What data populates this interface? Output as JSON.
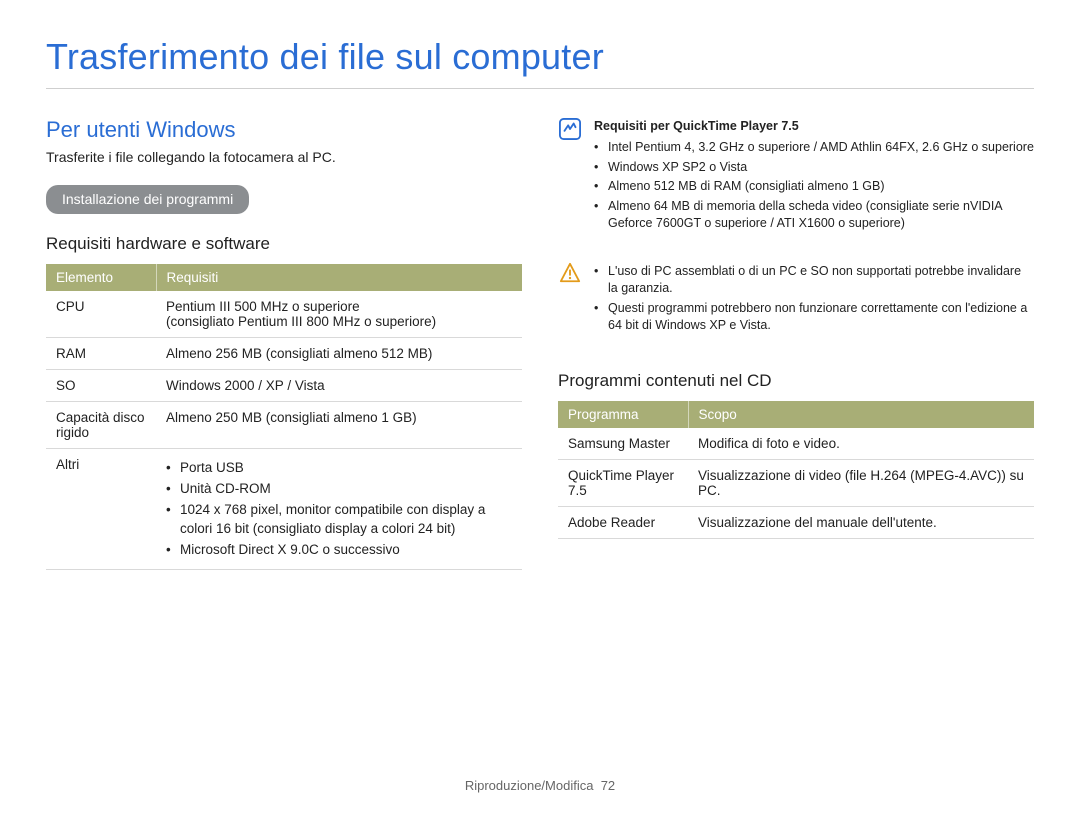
{
  "page": {
    "title": "Trasferimento dei file sul computer",
    "footer_section": "Riproduzione/Modifica",
    "footer_page": "72"
  },
  "left": {
    "heading": "Per utenti Windows",
    "lead": "Trasferite i file collegando la fotocamera al PC.",
    "pill": "Installazione dei programmi",
    "subheading": "Requisiti hardware e software",
    "table": {
      "head": {
        "col1": "Elemento",
        "col2": "Requisiti"
      },
      "rows": [
        {
          "c1": "CPU",
          "c2": "Pentium III 500 MHz o superiore\n(consigliato Pentium III 800 MHz o superiore)"
        },
        {
          "c1": "RAM",
          "c2": "Almeno 256 MB (consigliati almeno 512 MB)"
        },
        {
          "c1": "SO",
          "c2": "Windows 2000 / XP / Vista"
        },
        {
          "c1": "Capacità disco rigido",
          "c2": "Almeno 250 MB (consigliati almeno 1 GB)"
        }
      ],
      "others_label": "Altri",
      "others_items": [
        "Porta USB",
        "Unità CD-ROM",
        "1024 x 768 pixel, monitor compatibile con display a colori 16 bit (consigliato display a colori 24 bit)",
        "Microsoft Direct X 9.0C o successivo"
      ]
    }
  },
  "right": {
    "note1": {
      "title": "Requisiti per QuickTime Player 7.5",
      "items": [
        "Intel Pentium 4, 3.2 GHz o superiore / AMD Athlin 64FX, 2.6 GHz o superiore",
        "Windows XP SP2 o Vista",
        "Almeno 512 MB di RAM (consigliati almeno 1 GB)",
        "Almeno 64 MB di memoria della scheda video (consigliate serie nVIDIA Geforce 7600GT o superiore / ATI X1600 o superiore)"
      ]
    },
    "note2": {
      "items": [
        "L'uso di PC assemblati o di un PC e SO non supportati potrebbe invalidare la garanzia.",
        "Questi programmi potrebbero non funzionare correttamente con l'edizione a 64 bit di Windows XP e Vista."
      ]
    },
    "cd_heading": "Programmi contenuti nel CD",
    "cd_table": {
      "head": {
        "col1": "Programma",
        "col2": "Scopo"
      },
      "rows": [
        {
          "c1": "Samsung Master",
          "c2": "Modifica di foto e video."
        },
        {
          "c1": "QuickTime Player 7.5",
          "c2": "Visualizzazione di video (file H.264 (MPEG-4.AVC)) su PC."
        },
        {
          "c1": "Adobe Reader",
          "c2": "Visualizzazione del manuale dell'utente."
        }
      ]
    }
  }
}
